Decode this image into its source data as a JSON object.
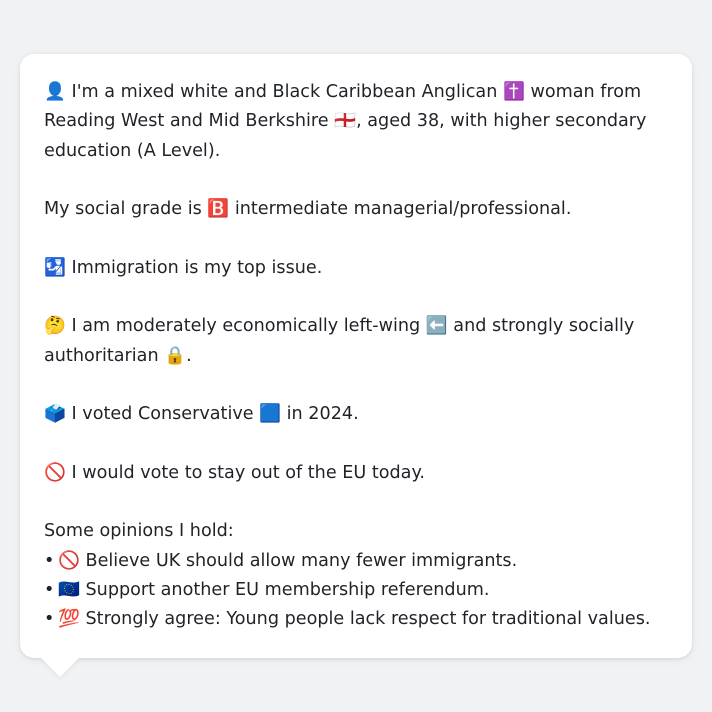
{
  "message": {
    "intro": "👤 I'm a mixed white and Black Caribbean Anglican ✝️ woman from Reading West and Mid Berkshire 🏴󠁧󠁢󠁥󠁮󠁧󠁿, aged 38, with higher secondary education (A Level).",
    "social_grade": "My social grade is 🅱️ intermediate managerial/professional.",
    "top_issue": "🛂 Immigration is my top issue.",
    "ideology": "🤔 I am moderately economically left-wing ⬅️ and strongly socially authoritarian 🔒.",
    "vote_2024": "🗳️ I voted Conservative 🟦 in 2024.",
    "eu_vote": "🚫 I would vote to stay out of the EU today.",
    "opinions_heading": "Some opinions I hold:",
    "bullet": "•",
    "opinions": [
      "🚫 Believe UK should allow many fewer immigrants.",
      "🇪🇺 Support another EU membership referendum.",
      "💯 Strongly agree: Young people lack respect for traditional values."
    ]
  }
}
